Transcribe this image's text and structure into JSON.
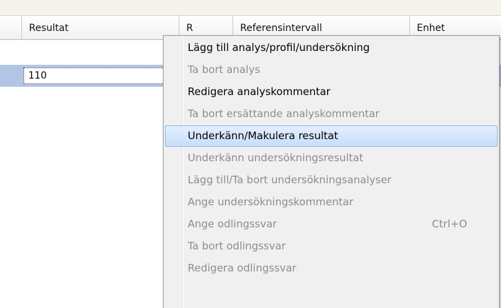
{
  "grid": {
    "columns": [
      "Resultat",
      "R",
      "Referensintervall",
      "Enhet"
    ],
    "selected_row": {
      "resultat": "110"
    }
  },
  "context_menu": {
    "items": [
      {
        "label": "Lägg till analys/profil/undersökning",
        "enabled": true
      },
      {
        "label": "Ta bort analys",
        "enabled": false
      },
      {
        "label": "Redigera analyskommentar",
        "enabled": true
      },
      {
        "label": "Ta bort ersättande analyskommentar",
        "enabled": false
      },
      {
        "label": "Underkänn/Makulera resultat",
        "enabled": true,
        "highlighted": true
      },
      {
        "label": "Underkänn undersökningsresultat",
        "enabled": false
      },
      {
        "label": "Lägg till/Ta bort undersökningsanalyser",
        "enabled": false
      },
      {
        "label": "Ange undersökningskommentar",
        "enabled": false
      },
      {
        "label": "Ange odlingssvar",
        "enabled": false,
        "shortcut": "Ctrl+O"
      },
      {
        "label": "Ta bort odlingssvar",
        "enabled": false
      },
      {
        "label": "Redigera odlingssvar",
        "enabled": false
      }
    ]
  },
  "colors": {
    "selection": "#b2c6e4",
    "menu_highlight": "#c8ddf8",
    "disabled_text": "#8d8d8d"
  }
}
